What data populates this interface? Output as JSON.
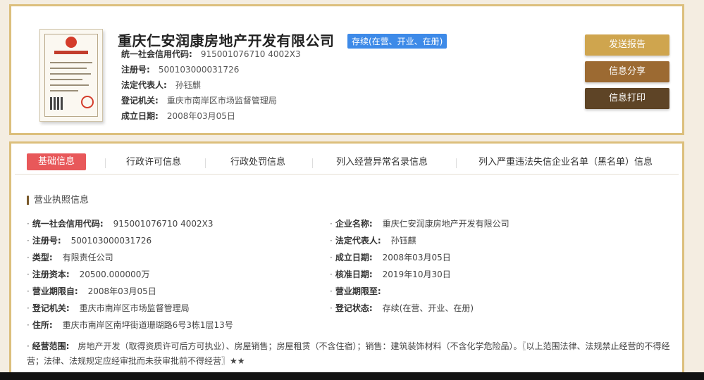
{
  "company": {
    "name": "重庆仁安润康房地产开发有限公司",
    "status_badge": "存续(在营、开业、在册)",
    "credit_code_label": "统一社会信用代码:",
    "credit_code": "915001076710 4002X3",
    "reg_no_label": "注册号:",
    "reg_no": "500103000031726",
    "legal_rep_label": "法定代表人:",
    "legal_rep": "孙钰麒",
    "authority_label": "登记机关:",
    "authority": "重庆市南岸区市场监督管理局",
    "est_date_label": "成立日期:",
    "est_date": "2008年03月05日"
  },
  "actions": {
    "send_report": "发送报告",
    "share": "信息分享",
    "print": "信息打印"
  },
  "tabs": [
    {
      "label": "基础信息"
    },
    {
      "label": "行政许可信息"
    },
    {
      "label": "行政处罚信息"
    },
    {
      "label": "列入经营异常名录信息"
    },
    {
      "label": "列入严重违法失信企业名单（黑名单）信息"
    }
  ],
  "section": {
    "title": "营业执照信息",
    "rows": [
      {
        "label": "统一社会信用代码:",
        "value": "915001076710 4002X3"
      },
      {
        "label": "企业名称:",
        "value": "重庆仁安润康房地产开发有限公司"
      },
      {
        "label": "注册号:",
        "value": "500103000031726"
      },
      {
        "label": "法定代表人:",
        "value": "孙钰麒"
      },
      {
        "label": "类型:",
        "value": "有限责任公司"
      },
      {
        "label": "成立日期:",
        "value": "2008年03月05日"
      },
      {
        "label": "注册资本:",
        "value": "20500.000000万"
      },
      {
        "label": "核准日期:",
        "value": "2019年10月30日"
      },
      {
        "label": "营业期限自:",
        "value": "2008年03月05日"
      },
      {
        "label": "营业期限至:",
        "value": ""
      },
      {
        "label": "登记机关:",
        "value": "重庆市南岸区市场监督管理局"
      },
      {
        "label": "登记状态:",
        "value": "存续(在营、开业、在册)"
      },
      {
        "label": "住所:",
        "value": "重庆市南岸区南坪街道珊瑚路6号3栋1层13号"
      }
    ],
    "scope_label": "经营范围:",
    "scope_value": "房地产开发（取得资质许可后方可执业）、房屋销售；房屋租赁（不含住宿）；销售：建筑装饰材料（不含化学危险品）。〖以上范围法律、法规禁止经营的不得经营；法律、法规规定应经审批而未获审批前不得经营〗★★"
  }
}
